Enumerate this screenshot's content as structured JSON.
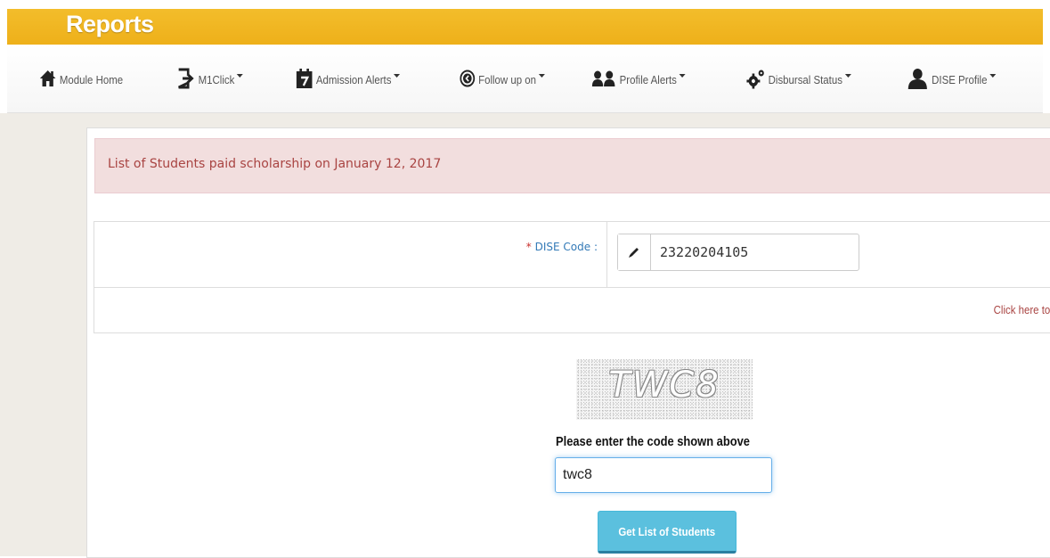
{
  "header": {
    "title": "Reports",
    "color": "#f0b41c"
  },
  "nav": {
    "items": [
      {
        "label": "Module Home",
        "icon": "home-icon",
        "dropdown": false
      },
      {
        "label": "M1Click",
        "icon": "sign-in-icon",
        "dropdown": true
      },
      {
        "label": "Admission Alerts",
        "icon": "calendar-icon",
        "dropdown": true
      },
      {
        "label": "Follow up on",
        "icon": "circle-arrow-icon",
        "dropdown": true
      },
      {
        "label": "Profile Alerts",
        "icon": "users-icon",
        "dropdown": true
      },
      {
        "label": "Disbursal Status",
        "icon": "cogs-icon",
        "dropdown": true
      },
      {
        "label": "DISE Profile",
        "icon": "user-icon",
        "dropdown": true
      }
    ]
  },
  "alert": {
    "text": "List of Students paid scholarship on January 12, 2017",
    "color": "#a94442",
    "background": "#f2dede"
  },
  "form": {
    "dise_label_required": "*",
    "dise_label": "DISE Code :",
    "dise_value": "23220204105",
    "link_text": "Click here to"
  },
  "captcha": {
    "image_text": "TWC8",
    "prompt": "Please enter the code shown above",
    "value": "twc8"
  },
  "submit": {
    "label": "Get List of Students",
    "color": "#5bc0de"
  }
}
